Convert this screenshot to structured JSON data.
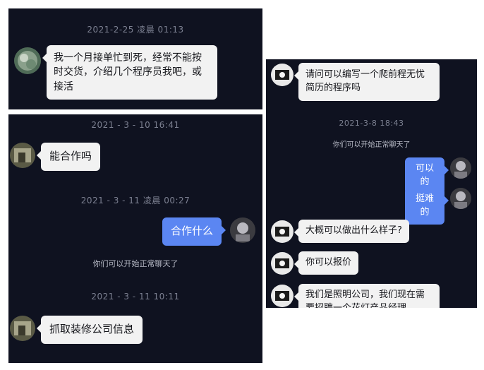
{
  "panel1": {
    "timestamp": "2021-2-25 凌晨 01:13",
    "msg1": "我一个月接单忙到死，经常不能按时交货，介绍几个程序员我吧，或接活"
  },
  "panel2": {
    "timestamp1": "2021 - 3 - 10 16:41",
    "msg1": "能合作吗",
    "timestamp2": "2021 - 3 - 11 凌晨 00:27",
    "msg2": "合作什么",
    "system": "你们可以开始正常聊天了",
    "timestamp3": "2021 - 3 - 11 10:11",
    "msg3": "抓取装修公司信息"
  },
  "panel3": {
    "msg1": "请问可以编写一个爬前程无忧简历的程序吗",
    "timestamp": "2021-3-8 18:43",
    "system": "你们可以开始正常聊天了",
    "msg2": "可以的",
    "msg3": "挺难的",
    "msg4": "大概可以做出什么样子?",
    "msg5": "你可以报价",
    "msg6": "我们是照明公司，我们现在需要招聘一个花灯产品经理"
  }
}
